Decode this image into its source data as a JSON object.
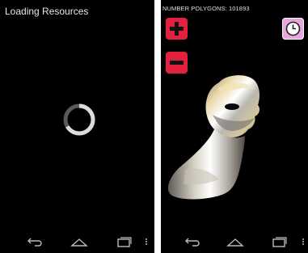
{
  "left_screen": {
    "title": "Loading Resources",
    "spinner_icon": "loading-spinner-icon"
  },
  "right_screen": {
    "polygon_count_text": "NUMBER POLYGONS: 101893",
    "zoom_in_icon": "plus-icon",
    "zoom_out_icon": "minus-icon",
    "clock_icon": "clock-icon",
    "model_subject": "3d-head-bust-model"
  },
  "navbar": {
    "back_icon": "back-icon",
    "home_icon": "home-icon",
    "recents_icon": "recents-icon",
    "menu_icon": "overflow-menu-icon"
  },
  "colors": {
    "button_red": "#e3213e",
    "clock_bg": "#e8a6df",
    "screen_bg": "#000000"
  }
}
